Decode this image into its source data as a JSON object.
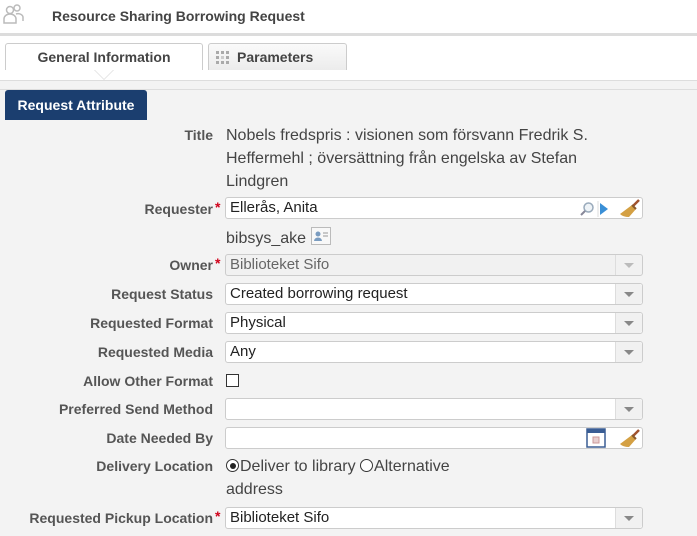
{
  "header": {
    "title": "Resource Sharing Borrowing Request",
    "icon": "users-group-icon"
  },
  "tabs": [
    {
      "label": "General Information",
      "active": true
    },
    {
      "label": "Parameters",
      "active": false,
      "icon": "grid-icon"
    }
  ],
  "section": {
    "label": "Request Attribute"
  },
  "form": {
    "title": {
      "label": "Title",
      "value_lines": [
        "Nobels fredspris : visionen som försvann Fredrik S.",
        "Heffermehl ; översättning från engelska av Stefan",
        "Lindgren"
      ]
    },
    "requester": {
      "label": "Requester",
      "required": "*",
      "value": "Ellerås, Anita",
      "user_id": "bibsys_ake",
      "icons": [
        "search-icon",
        "play-arrow-icon",
        "broom-clear-icon",
        "user-card-icon"
      ]
    },
    "owner": {
      "label": "Owner",
      "required": "*",
      "value": "Biblioteket Sifo",
      "disabled": true
    },
    "request_status": {
      "label": "Request Status",
      "value": "Created borrowing request"
    },
    "requested_format": {
      "label": "Requested Format",
      "value": "Physical"
    },
    "requested_media": {
      "label": "Requested Media",
      "value": "Any"
    },
    "allow_other_format": {
      "label": "Allow Other Format",
      "checked": false
    },
    "preferred_send_method": {
      "label": "Preferred Send Method",
      "value": ""
    },
    "date_needed_by": {
      "label": "Date Needed By",
      "value": "",
      "icons": [
        "calendar-icon",
        "broom-clear-icon"
      ]
    },
    "delivery_location": {
      "label": "Delivery Location",
      "options": [
        {
          "label": "Deliver to library",
          "checked": true
        },
        {
          "label": "Alternative",
          "checked": false
        }
      ],
      "wrap_text": "address"
    },
    "requested_pickup_location": {
      "label": "Requested Pickup Location",
      "required": "*",
      "value": "Biblioteket Sifo"
    }
  }
}
